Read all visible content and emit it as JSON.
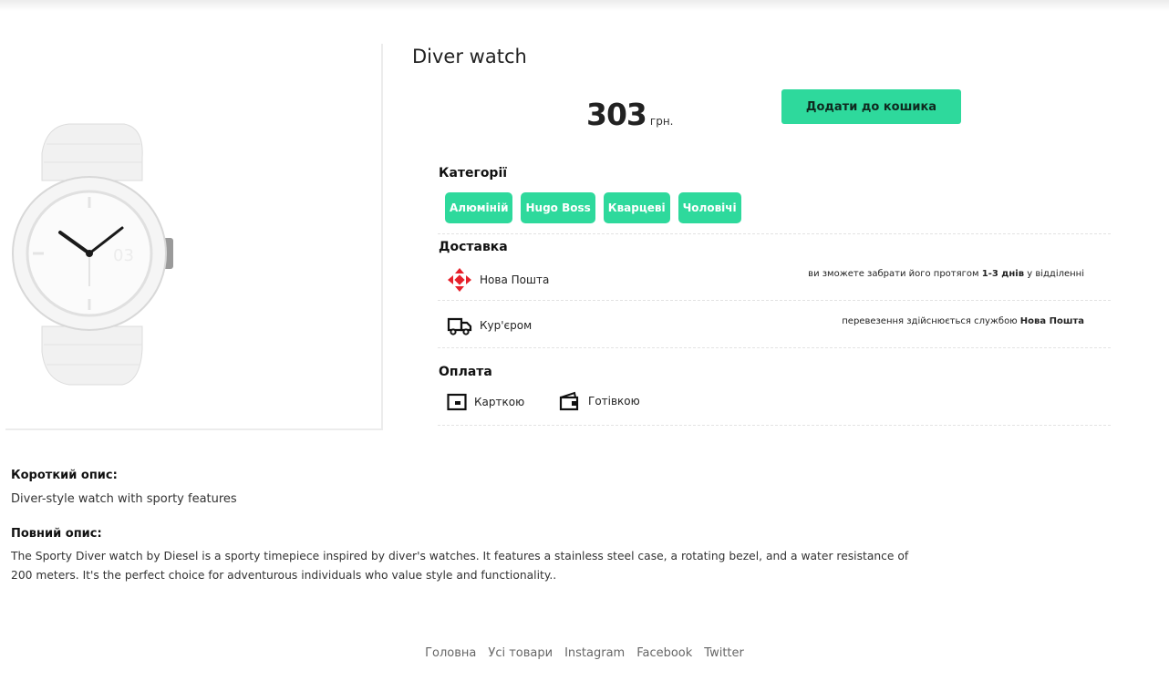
{
  "product": {
    "title": "Diver watch",
    "price": "303",
    "currency": "грн.",
    "add_to_cart_label": "Додати до кошика"
  },
  "categories": {
    "heading": "Категорії",
    "items": [
      "Алюміній",
      "Hugo Boss",
      "Кварцеві",
      "Чоловічі"
    ]
  },
  "delivery": {
    "heading": "Доставка",
    "options": [
      {
        "label": "Нова Пошта",
        "icon": "nova-poshta-icon",
        "note_pre": "ви зможете забрати його протягом ",
        "note_bold": "1-3 днів",
        "note_post": " у відділенні"
      },
      {
        "label": "Кур'єром",
        "icon": "truck-icon",
        "note_pre": "перевезення здійснюється службою ",
        "note_bold": "Нова Пошта",
        "note_post": ""
      }
    ]
  },
  "payment": {
    "heading": "Оплата",
    "options": [
      {
        "label": "Карткою",
        "icon": "card-icon"
      },
      {
        "label": "Готівкою",
        "icon": "wallet-icon"
      }
    ]
  },
  "description": {
    "short_heading": "Короткий опис:",
    "short_text": "Diver-style watch with sporty features",
    "full_heading": "Повний опис:",
    "full_line1": "The Sporty Diver watch by Diesel is a sporty timepiece inspired by diver's watches. It features a stainless steel case, a rotating bezel, and a water resistance of",
    "full_line2": "200 meters. It's the perfect choice for adventurous individuals who value style and functionality.."
  },
  "footer": {
    "links": [
      "Головна",
      "Усі товари",
      "Instagram",
      "Facebook",
      "Twitter"
    ]
  },
  "colors": {
    "accent": "#2ed99c",
    "nova_poshta_red": "#e6212b"
  }
}
